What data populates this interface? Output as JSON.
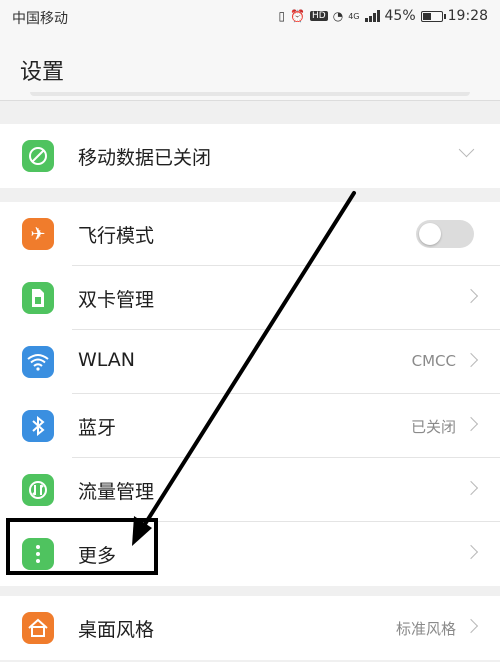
{
  "status_bar": {
    "carrier": "中国移动",
    "network": "4G",
    "battery": "45%",
    "battery_level": 0.45,
    "time": "19:28",
    "icons": [
      "vibrate-icon",
      "alarm-icon",
      "hd-icon",
      "wifi-icon",
      "signal-icon",
      "battery-icon"
    ]
  },
  "header": {
    "title": "设置"
  },
  "mobile_data": {
    "label": "移动数据已关闭",
    "icon": "mobile-data-off-icon",
    "color": "#4fc35f"
  },
  "settings": [
    {
      "label": "飞行模式",
      "icon": "airplane-icon",
      "color": "#f07c2c",
      "value": "",
      "toggle": false
    },
    {
      "label": "双卡管理",
      "icon": "sim-card-icon",
      "color": "#4fc35f",
      "value": ""
    },
    {
      "label": "WLAN",
      "icon": "wifi-icon",
      "color": "#3a8fe0",
      "value": "CMCC"
    },
    {
      "label": "蓝牙",
      "icon": "bluetooth-icon",
      "color": "#3a8fe0",
      "value": "已关闭"
    },
    {
      "label": "流量管理",
      "icon": "data-usage-icon",
      "color": "#4fc35f",
      "value": ""
    },
    {
      "label": "更多",
      "icon": "more-icon",
      "color": "#4fc35f",
      "value": ""
    }
  ],
  "display": [
    {
      "label": "桌面风格",
      "icon": "home-style-icon",
      "color": "#f07c2c",
      "value": "标准风格"
    }
  ]
}
